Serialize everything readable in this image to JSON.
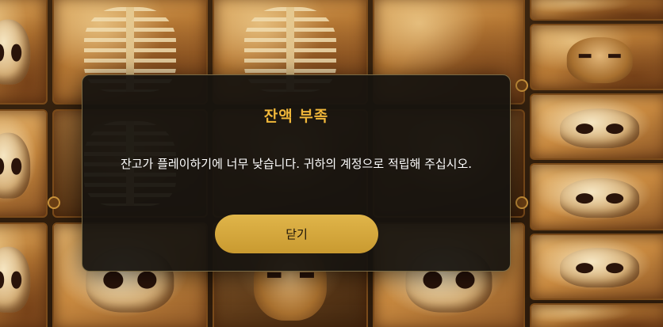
{
  "modal": {
    "title": "잔액 부족",
    "message": "잔고가 플레이하기에 너무 낮습니다. 귀하의 계정으로 적립해 주십시오.",
    "close_label": "닫기"
  },
  "colors": {
    "title_accent": "#f0b73a",
    "button_bg": "#d4a63a",
    "modal_bg": "#16130f"
  },
  "board": {
    "reels": [
      [
        "skull",
        "skull",
        "skull"
      ],
      [
        "ribs",
        "ribs",
        "skull"
      ],
      [
        "ribs",
        "dark",
        "face"
      ],
      [
        "dark",
        "dark",
        "skull"
      ],
      [
        "face",
        "skull",
        "skull",
        "skull",
        "skull"
      ]
    ]
  }
}
